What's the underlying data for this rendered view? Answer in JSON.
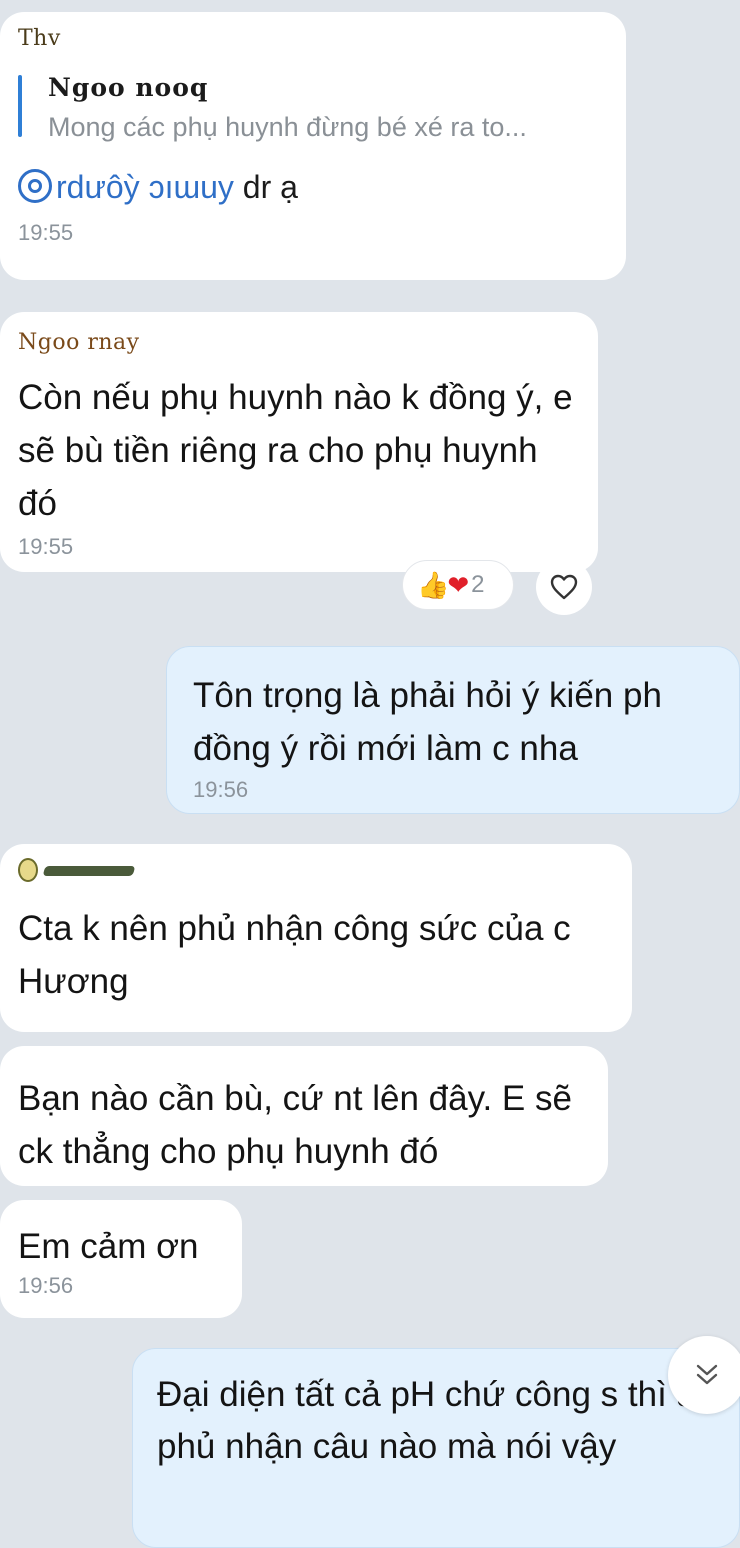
{
  "messages": [
    {
      "sender": "Thv",
      "quote_name": "Ngoo nooq",
      "quote_text": "Mong các phụ huynh đừng bé xé ra to...",
      "mention": "rdưôỳ ɔıɯuy",
      "mention_suffix": " dr ạ",
      "time": "19:55"
    },
    {
      "sender": "Ngoo rnay",
      "text": "Còn nếu phụ huynh nào k đồng ý, e sẽ bù tiền riêng ra cho phụ huynh đó",
      "time": "19:55",
      "reactions": {
        "count": "2",
        "icons": [
          "thumbs-up",
          "heart"
        ]
      }
    },
    {
      "text": "Tôn trọng là phải hỏi ý kiến ph đồng ý rồi mới làm c nha",
      "time": "19:56"
    },
    {
      "text": "Cta k nên phủ nhận công sức của c Hương"
    },
    {
      "text": "Bạn nào cần bù, cứ nt lên đây. E sẽ ck thẳng cho phụ huynh đó"
    },
    {
      "text": "Em cảm ơn",
      "time": "19:56"
    },
    {
      "text": "Đại diện tất cả pH chứ công s thì ai phủ nhận câu nào mà nói vậy"
    }
  ],
  "colors": {
    "background": "#dfe4ea",
    "incoming_bubble": "#ffffff",
    "outgoing_bubble": "#e3f1fd",
    "link": "#2f6fc7",
    "timestamp": "#8b939b"
  }
}
